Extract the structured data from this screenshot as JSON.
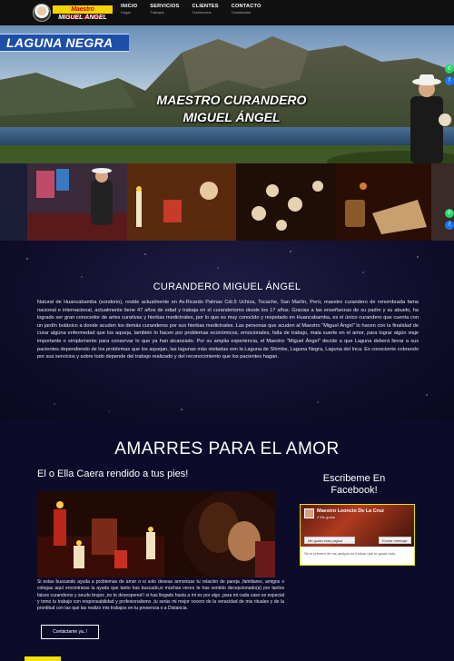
{
  "nav": {
    "logo_line1": "Maestro CURANDERO",
    "logo_line2": "MIGUEL ÁNGEL",
    "items": [
      {
        "label": "INICIO",
        "sub": "Hogar"
      },
      {
        "label": "SERVICIOS",
        "sub": "Trabajos"
      },
      {
        "label": "CLIENTES",
        "sub": "Testimonios"
      },
      {
        "label": "CONTACTO",
        "sub": "Contáctame"
      }
    ]
  },
  "hero": {
    "banner": "LAGUNA NEGRA",
    "title_line1": "MAESTRO CURANDERO",
    "title_line2": "MIGUEL ÁNGEL"
  },
  "about": {
    "heading": "CURANDERO MIGUEL ÁNGEL",
    "text": "Natural de Huancabamba (sondorio), reside actualmente en Av.Ricardo Palmas Cdr.5 Uchiza, Tocache, San Martín, Perú, maestro curandero de renombrada fama nacional e internacional, actualmente tiene 47 años de edad y trabaja en el curanderismo desde los 17 años. Gracias a las enseñanzas de su padre y su abuelo, ha logrado ser gran conocedor de artes curativas y hierbas medicinales, por lo que es muy conocido y respetado en Huancabamba, es el único curandero que cuenta con un jardín botánico a donde acuden los demás curanderos por sus hierbas medicinales. Las personas que acuden al Maestro \"Miguel Ángel\" lo hacen con la finalidad de curar alguna enfermedad que los aqueja, también lo hacen por problemas económicos, emocionales, falta de trabajo, mala suerte en el amor, para lograr algún viaje importante o simplemente para conservar lo que ya han alcanzado. Por su amplia experiencia, el Maestro \"Miguel Ángel\" decide a que Laguna deberá llevar a sus pacientes dependiendo de los problemas que los aquejan, las lagunas más visitadas son la Laguna de Shimbe, Laguna Negra, Laguna del Inca. Es consciente cobrando por sus servicios y sobre todo depende del trabajo realizado y del reconocimiento que los pacientes hagan."
  },
  "amarres": {
    "heading": "AMARRES PARA EL AMOR",
    "subheading": "El o Ella Caera rendido a tus pies!",
    "text": "Si estas buscando ayuda a problemas de amor o si solo deseas armonizar tu relación de pareja ,familiares, amigos o colegas aquí encontraras la ayuda que tanto has buscado,si muchas veces te has sentido decepcionado(a) por tantos falsos curanderos y seudo brujos ,no te desesperes!! si has llegado hasta a mi es por algo ,para mi cada caso es especial y tomo tu trabajo con responsabilidad y profesionalismo ,tu serás mi mejor vocero de la veracidad de mis rituales y de la prontitud con las que las realizo mis trabajos en tu presencia o a Distancia.",
    "button": "Contáctame ya..!",
    "fb_title": "Escribeme En Facebook!",
    "fb_page": {
      "name": "Maestro Leoncio De La Cruz",
      "followers": "2 Me gusta",
      "like": "Me gusta esta página",
      "share": "Enviar mensaje",
      "footer": "Sé el primero de tus amigos en indicar que te gusta esto."
    }
  },
  "colors": {
    "accent_yellow": "#f5d400",
    "banner_blue": "#1d4fa8",
    "whatsapp": "#25d366",
    "facebook": "#1877f2"
  }
}
